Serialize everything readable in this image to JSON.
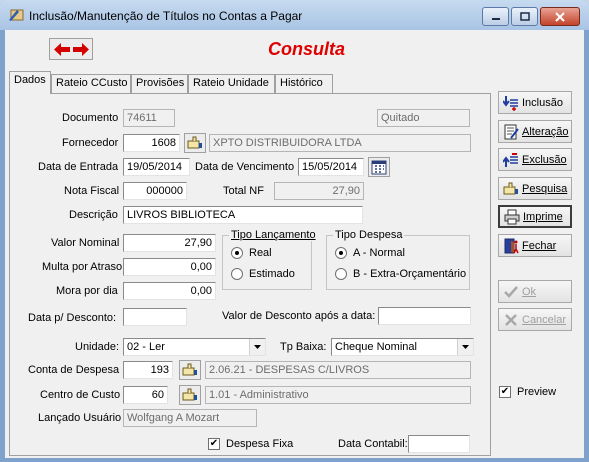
{
  "window": {
    "title": "Inclusão/Manutenção de Títulos no Contas a Pagar"
  },
  "header": {
    "mode": "Consulta"
  },
  "tabs": [
    "Dados",
    "Rateio CCusto",
    "Provisões",
    "Rateio Unidade",
    "Histórico"
  ],
  "form": {
    "documento": {
      "label": "Documento",
      "value": "74611"
    },
    "status": "Quitado",
    "fornecedor": {
      "label": "Fornecedor",
      "code": "1608",
      "name": "XPTO DISTRIBUIDORA LTDA"
    },
    "data_entrada": {
      "label": "Data de Entrada",
      "value": "19/05/2014"
    },
    "data_vencimento": {
      "label": "Data de Vencimento",
      "value": "15/05/2014"
    },
    "nota_fiscal": {
      "label": "Nota Fiscal",
      "value": "000000"
    },
    "total_nf": {
      "label": "Total NF",
      "value": "27,90"
    },
    "descricao": {
      "label": "Descrição",
      "value": "LIVROS BIBLIOTECA"
    },
    "valor_nominal": {
      "label": "Valor Nominal",
      "value": "27,90"
    },
    "multa": {
      "label": "Multa por Atraso",
      "value": "0,00"
    },
    "mora": {
      "label": "Mora por dia",
      "value": "0,00"
    },
    "data_desconto": {
      "label": "Data p/ Desconto:",
      "value": ""
    },
    "valor_desconto": {
      "label": "Valor de Desconto após a data:",
      "value": ""
    },
    "tipo_lancamento": {
      "label": "Tipo Lançamento",
      "options": [
        "Real",
        "Estimado"
      ],
      "selected": "Real"
    },
    "tipo_despesa": {
      "label": "Tipo Despesa",
      "options": [
        "A - Normal",
        "B - Extra-Orçamentário"
      ],
      "selected": "A - Normal"
    },
    "unidade": {
      "label": "Unidade:",
      "value": "02 - Ler"
    },
    "tp_baixa": {
      "label": "Tp Baixa:",
      "value": "Cheque Nominal"
    },
    "conta_despesa": {
      "label": "Conta de Despesa",
      "code": "193",
      "name": "2.06.21 - DESPESAS C/LIVROS"
    },
    "centro_custo": {
      "label": "Centro de Custo",
      "code": "60",
      "name": "1.01 - Administrativo"
    },
    "lancado_usuario": {
      "label": "Lançado Usuário",
      "value": "Wolfgang A Mozart"
    },
    "despesa_fixa": {
      "label": "Despesa Fixa",
      "checked": true
    },
    "data_contabil": {
      "label": "Data Contabil:",
      "value": ""
    }
  },
  "actions": {
    "inclusao": "Inclusão",
    "alteracao": "Alteração",
    "exclusao": "Exclusão",
    "pesquisa": "Pesquisa",
    "imprime": "Imprime",
    "fechar": "Fechar",
    "ok": "Ok",
    "cancelar": "Cancelar"
  },
  "preview": {
    "label": "Preview",
    "checked": true
  },
  "colors": {
    "mode_title": "#e00000",
    "nav_arrow": "#d40000",
    "titlebar": "#b9cfea"
  }
}
